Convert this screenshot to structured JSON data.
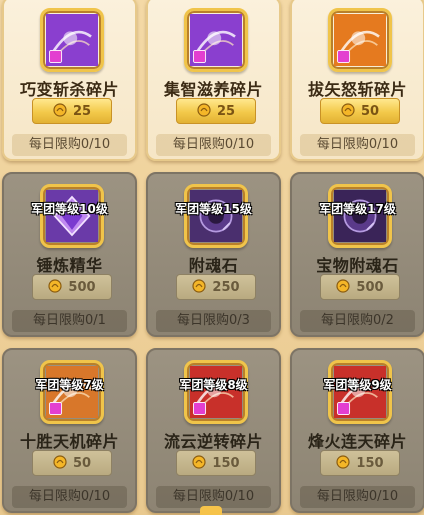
{
  "items": [
    {
      "name": "巧变斩杀碎片",
      "price": "25",
      "limit": "每日限购0/10",
      "locked": false,
      "level": "",
      "icon": "purple-fragment-icon",
      "color": "#8a3fcf"
    },
    {
      "name": "集智滋养碎片",
      "price": "25",
      "limit": "每日限购0/10",
      "locked": false,
      "level": "",
      "icon": "purple-fragment-icon",
      "color": "#8a3fcf"
    },
    {
      "name": "拔矢怒斩碎片",
      "price": "50",
      "limit": "每日限购0/10",
      "locked": false,
      "level": "",
      "icon": "orange-fragment-icon",
      "color": "#e57a1f"
    },
    {
      "name": "锤炼精华",
      "price": "500",
      "limit": "每日限购0/1",
      "locked": true,
      "level": "军团等级10级",
      "icon": "purple-crystal-icon",
      "color": "#6a3aa8"
    },
    {
      "name": "附魂石",
      "price": "250",
      "limit": "每日限购0/3",
      "locked": true,
      "level": "军团等级15级",
      "icon": "dark-gem-icon",
      "color": "#4a2f6e"
    },
    {
      "name": "宝物附魂石",
      "price": "500",
      "limit": "每日限购0/2",
      "locked": true,
      "level": "军团等级17级",
      "icon": "dark-gem-icon",
      "color": "#3a2458"
    },
    {
      "name": "十胜天机碎片",
      "price": "50",
      "limit": "每日限购0/10",
      "locked": true,
      "level": "军团等级7级",
      "icon": "orange-fragment-icon",
      "color": "#d8772a"
    },
    {
      "name": "流云逆转碎片",
      "price": "150",
      "limit": "每日限购0/10",
      "locked": true,
      "level": "军团等级8级",
      "icon": "red-fragment-icon",
      "color": "#c8302a"
    },
    {
      "name": "烽火连天碎片",
      "price": "150",
      "limit": "每日限购0/10",
      "locked": true,
      "level": "军团等级9级",
      "icon": "red-fragment-icon",
      "color": "#c8302a"
    }
  ]
}
